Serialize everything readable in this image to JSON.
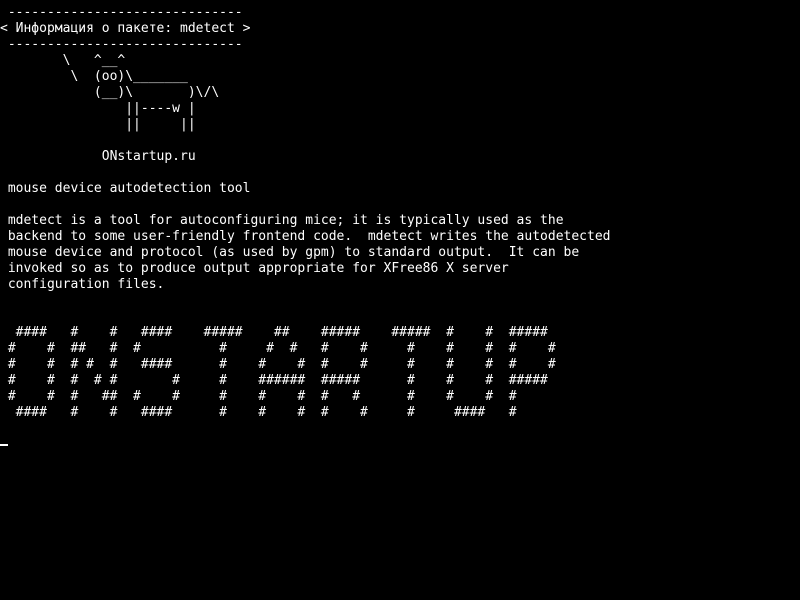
{
  "terminal": {
    "lines": [
      " ------------------------------",
      "< Информация о пакете: mdetect >",
      " ------------------------------",
      "        \\   ^__^",
      "         \\  (oo)\\_______",
      "            (__)\\       )\\/\\",
      "                ||----w |",
      "                ||     ||",
      "",
      "             ONstartup.ru",
      "",
      " mouse device autodetection tool",
      "",
      " mdetect is a tool for autoconfiguring mice; it is typically used as the",
      " backend to some user-friendly frontend code.  mdetect writes the autodetected",
      " mouse device and protocol (as used by gpm) to standard output.  It can be",
      " invoked so as to produce output appropriate for XFree86 X server",
      " configuration files.",
      "",
      "",
      "  ####   #    #   ####    #####    ##    #####    #####  #    #  #####",
      " #    #  ##   #  #          #     #  #   #    #     #    #    #  #    #",
      " #    #  # #  #   ####      #    #    #  #    #     #    #    #  #    #",
      " #    #  #  # #       #     #    ######  #####      #    #    #  #####",
      " #    #  #   ##  #    #     #    #    #  #   #      #    #    #  #",
      "  ####   #    #   ####      #    #    #  #    #     #     ####   #"
    ]
  },
  "colors": {
    "background": "#000000",
    "foreground": "#ffffff"
  }
}
